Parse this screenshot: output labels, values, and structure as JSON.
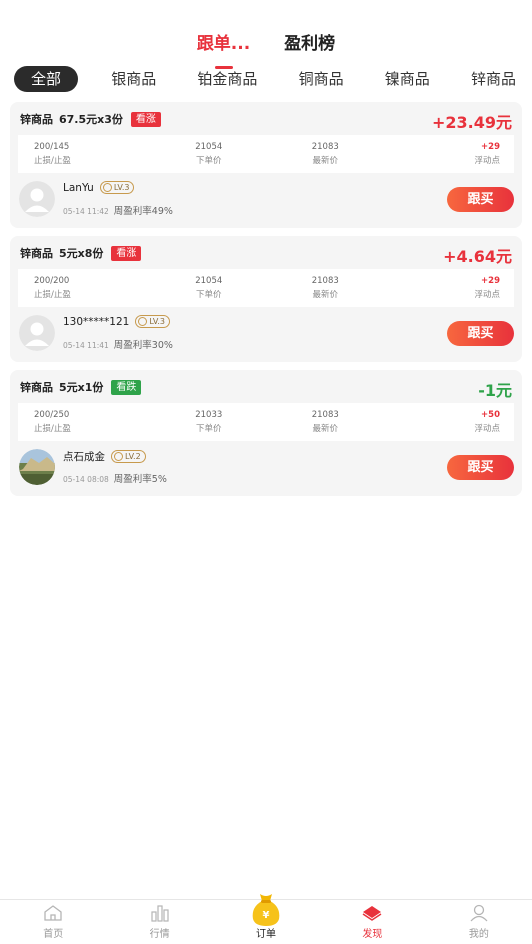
{
  "top_tabs": [
    {
      "label": "跟单..."
    },
    {
      "label": "盈利榜"
    }
  ],
  "categories": [
    "全部",
    "银商品",
    "铂金商品",
    "铜商品",
    "镍商品",
    "锌商品"
  ],
  "stat_labels": {
    "stop": "止损/止盈",
    "order_price": "下单价",
    "latest_price": "最新价",
    "floating": "浮动点"
  },
  "follow_label": "跟买",
  "orders": [
    {
      "product": "锌商品",
      "spec": "67.5元x3份",
      "direction": "看涨",
      "direction_color": "#e8323c",
      "profit": "+23.49元",
      "profit_color": "#e8323c",
      "stop": "200/145",
      "order_price": "21054",
      "latest_price": "21083",
      "floating": "+29",
      "user": "LanYu",
      "level": "LV.3",
      "time": "05-14 11:42",
      "rate": "周盈利率49%",
      "avatar": "default"
    },
    {
      "product": "锌商品",
      "spec": "5元x8份",
      "direction": "看涨",
      "direction_color": "#e8323c",
      "profit": "+4.64元",
      "profit_color": "#e8323c",
      "stop": "200/200",
      "order_price": "21054",
      "latest_price": "21083",
      "floating": "+29",
      "user": "130*****121",
      "level": "LV.3",
      "time": "05-14 11:41",
      "rate": "周盈利率30%",
      "avatar": "default"
    },
    {
      "product": "锌商品",
      "spec": "5元x1份",
      "direction": "看跌",
      "direction_color": "#2fa34a",
      "profit": "-1元",
      "profit_color": "#2fa34a",
      "stop": "200/250",
      "order_price": "21033",
      "latest_price": "21083",
      "floating": "+50",
      "user": "点石成金",
      "level": "LV.2",
      "time": "05-14 08:08",
      "rate": "周盈利率5%",
      "avatar": "photo"
    }
  ],
  "nav": [
    {
      "label": "首页",
      "icon": "home-icon"
    },
    {
      "label": "行情",
      "icon": "chart-icon"
    },
    {
      "label": "订单",
      "icon": "money-bag-icon"
    },
    {
      "label": "发现",
      "icon": "discover-icon"
    },
    {
      "label": "我的",
      "icon": "profile-icon"
    }
  ],
  "colors": {
    "accent": "#e8323c",
    "down": "#2fa34a",
    "gold": "#c79a4d"
  }
}
